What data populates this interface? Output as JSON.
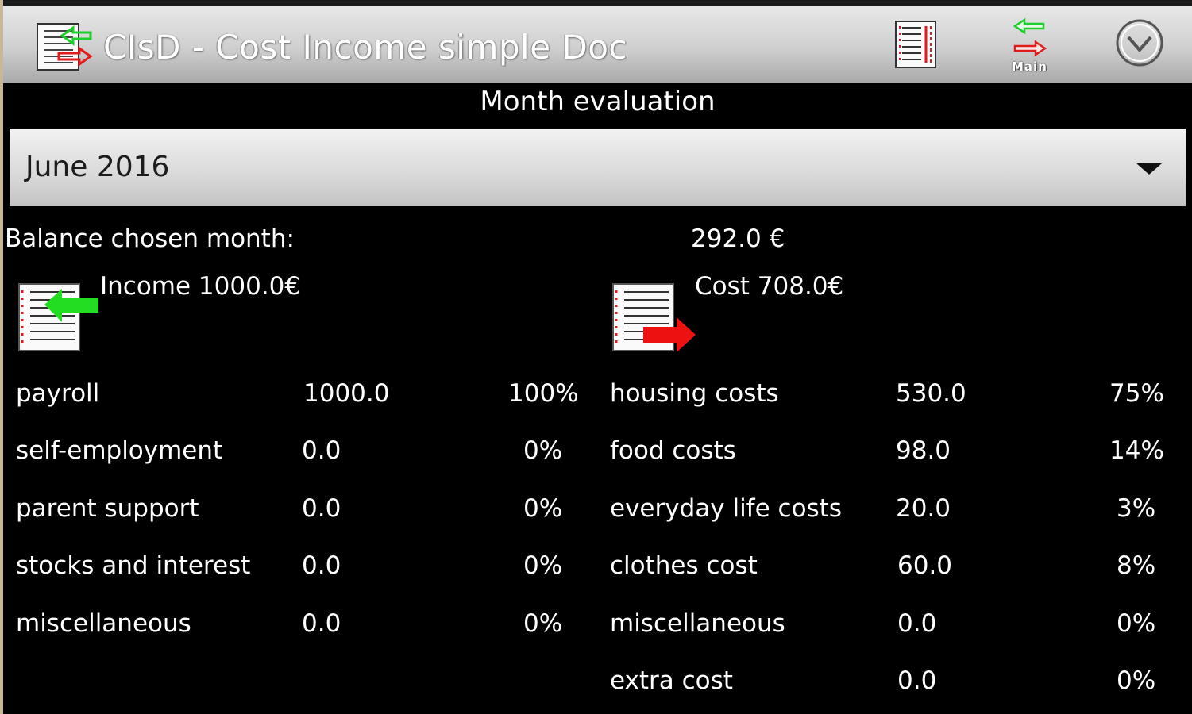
{
  "actionbar": {
    "title": "CIsD - Cost Income simple Doc",
    "app_icon": "document-arrows-icon",
    "menu_doc_icon": "document-list-icon",
    "main_label": "Main",
    "overflow_icon": "chevron-down-circle-icon"
  },
  "page": {
    "subtitle": "Month evaluation"
  },
  "month_select": {
    "value": "June 2016"
  },
  "balance": {
    "label": "Balance chosen month:",
    "value": "292.0 €"
  },
  "income": {
    "header": "Income 1000.0€",
    "rows": [
      {
        "label": "payroll",
        "amount": "1000.0",
        "percent": "100%"
      },
      {
        "label": "self-employment",
        "amount": "0.0",
        "percent": "0%"
      },
      {
        "label": "parent support",
        "amount": "0.0",
        "percent": "0%"
      },
      {
        "label": "stocks and interest",
        "amount": "0.0",
        "percent": "0%"
      },
      {
        "label": "miscellaneous",
        "amount": "0.0",
        "percent": "0%"
      }
    ]
  },
  "cost": {
    "header": "Cost 708.0€",
    "rows": [
      {
        "label": "housing costs",
        "amount": "530.0",
        "percent": "75%"
      },
      {
        "label": "food costs",
        "amount": "98.0",
        "percent": "14%"
      },
      {
        "label": "everyday life costs",
        "amount": "20.0",
        "percent": "3%"
      },
      {
        "label": "clothes cost",
        "amount": "60.0",
        "percent": "8%"
      },
      {
        "label": "miscellaneous",
        "amount": "0.0",
        "percent": "0%"
      },
      {
        "label": "extra cost",
        "amount": "0.0",
        "percent": "0%"
      }
    ]
  },
  "colors": {
    "income_arrow": "#22dd22",
    "cost_arrow": "#ee1111",
    "background": "#000000",
    "text": "#ffffff"
  }
}
